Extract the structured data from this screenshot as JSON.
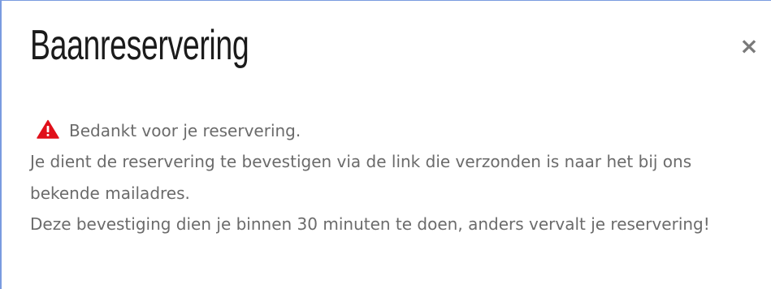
{
  "dialog": {
    "title": "Baanreservering",
    "close_label": "×"
  },
  "message": {
    "icon": "warning-triangle-icon",
    "icon_color": "#e0101a",
    "line1": "Bedankt voor je reservering.",
    "line2": "Je dient de reservering te bevestigen via de link die verzonden is naar het bij ons bekende mailadres.",
    "line3": "Deze bevestiging dien je binnen 30 minuten te doen, anders vervalt je reservering!"
  },
  "colors": {
    "border": "#7a9be0",
    "text": "#6b6b6b",
    "title": "#1b1b1b"
  }
}
